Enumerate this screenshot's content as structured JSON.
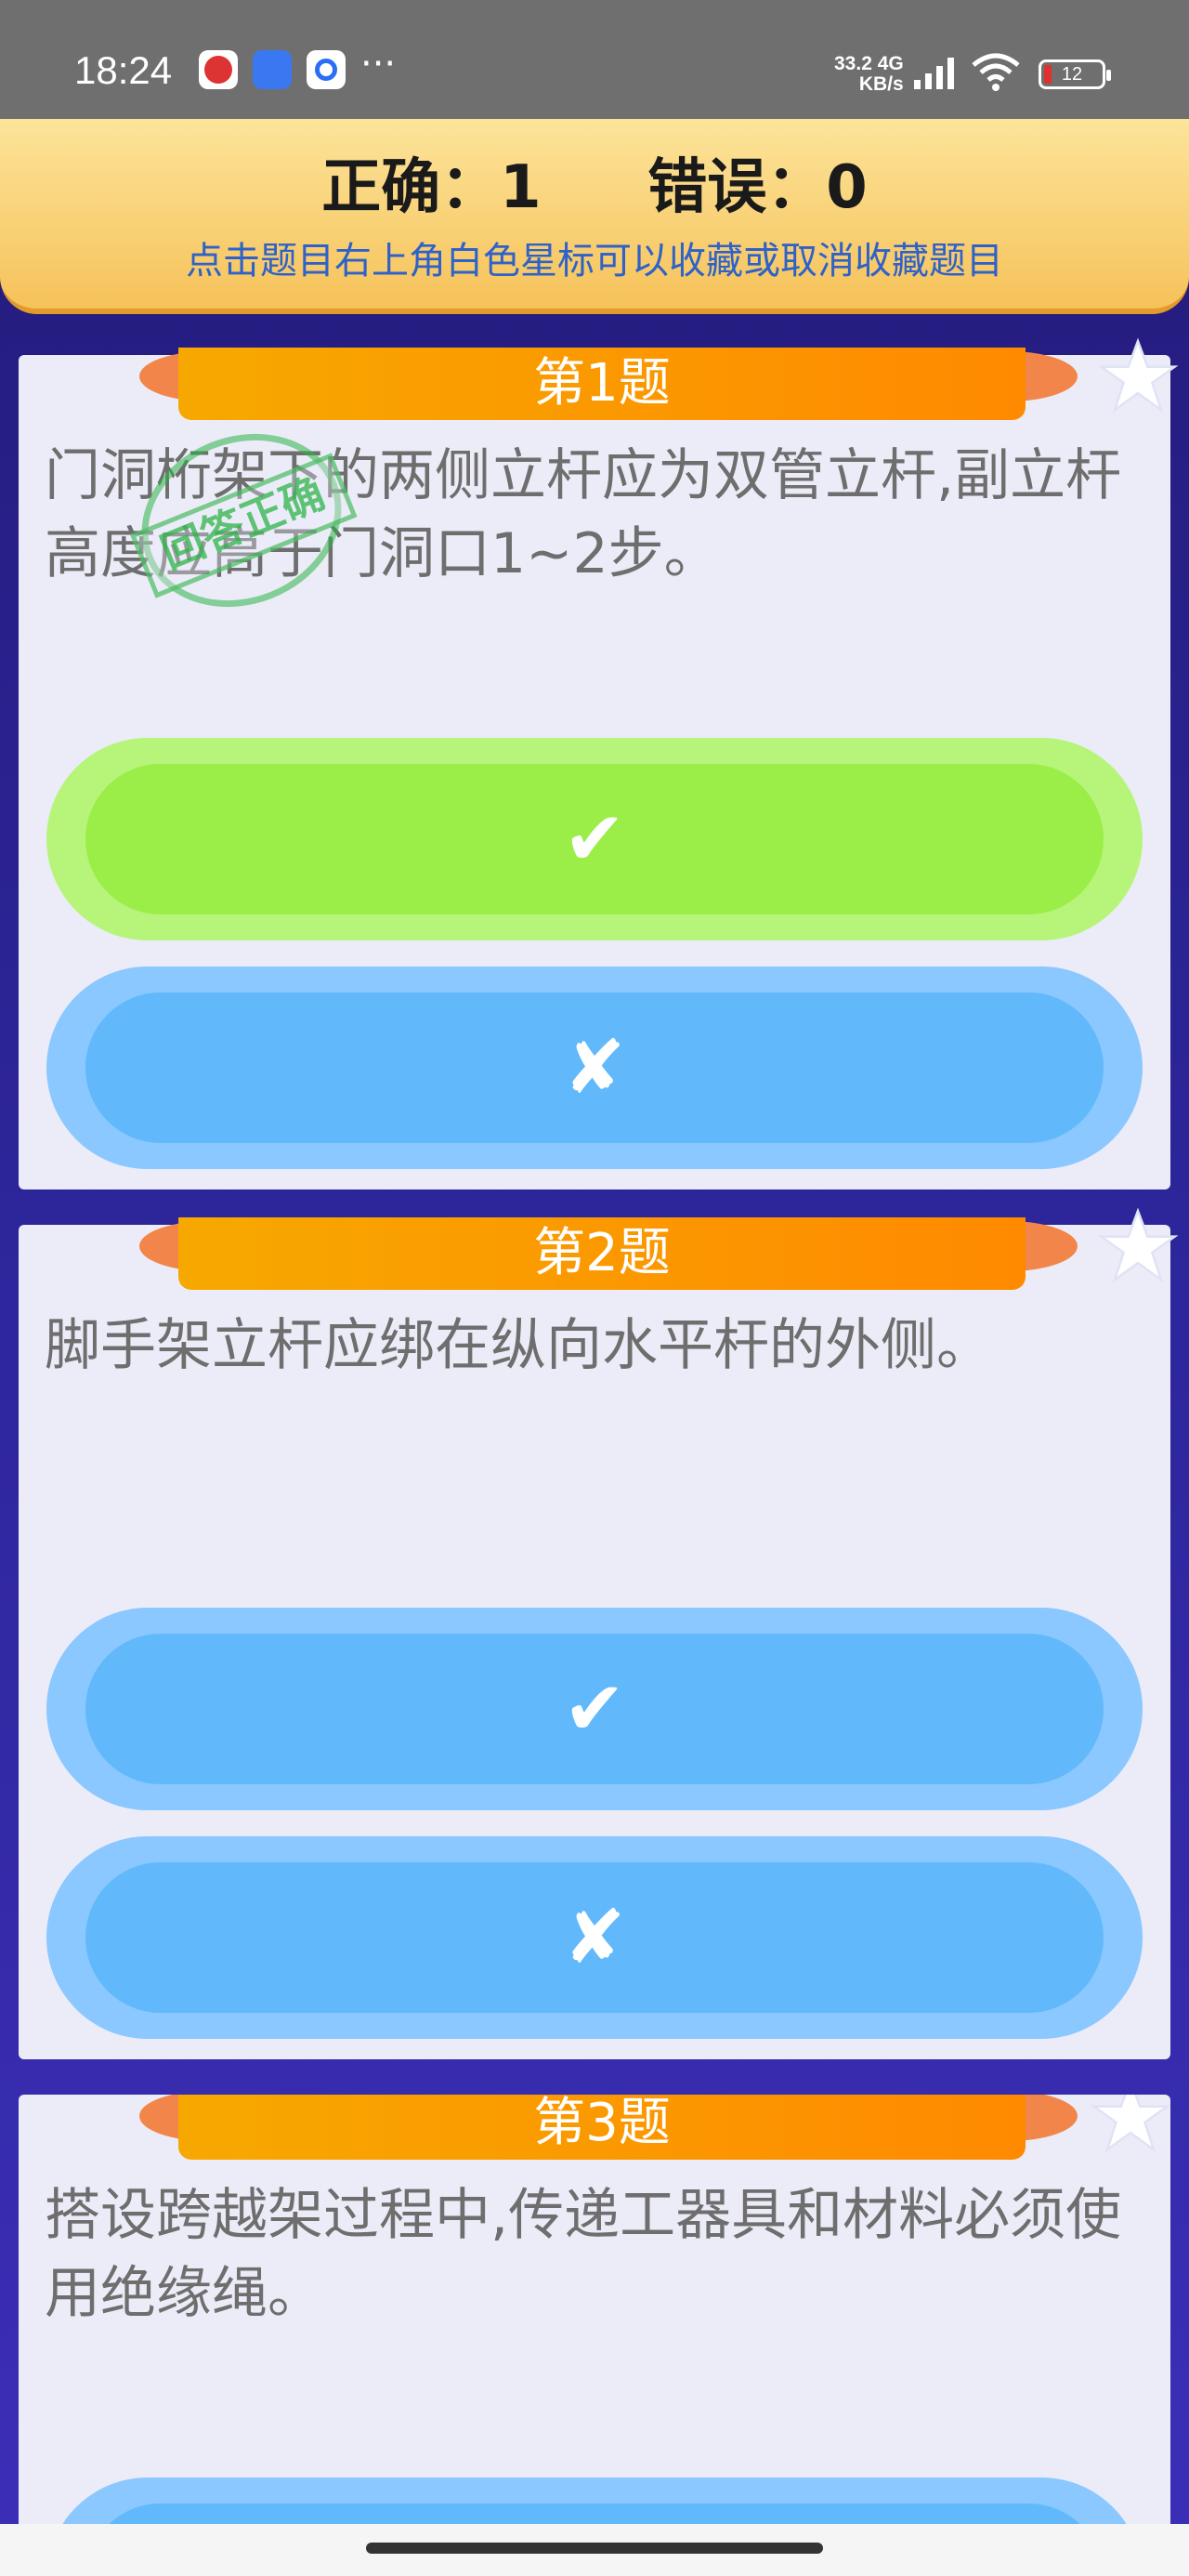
{
  "status_bar": {
    "time": "18:24",
    "net_speed_value": "33.2",
    "net_speed_unit": "KB/s",
    "net_type": "4G",
    "battery": "12",
    "more": "···"
  },
  "score": {
    "correct_label": "正确：1",
    "wrong_label": "错误：0",
    "hint": "点击题目右上角白色星标可以收藏或取消收藏题目"
  },
  "questions": [
    {
      "title": "第1题",
      "text": "门洞桁架下的两侧立杆应为双管立杆,副立杆高度应高于门洞口1~2步。",
      "options": [
        "✔",
        "✘"
      ],
      "stamp": "回答正确"
    },
    {
      "title": "第2题",
      "text": "脚手架立杆应绑在纵向水平杆的外侧。",
      "options": [
        "✔",
        "✘"
      ]
    },
    {
      "title": "第3题",
      "text": "搭设跨越架过程中,传递工器具和材料必须使用绝缘绳。",
      "options": [
        "✔"
      ]
    }
  ],
  "colors": {
    "option_default": "#61b8fb",
    "option_correct": "#9bed48",
    "ribbon": "#ff8a00",
    "hint_text": "#2f62c8"
  }
}
